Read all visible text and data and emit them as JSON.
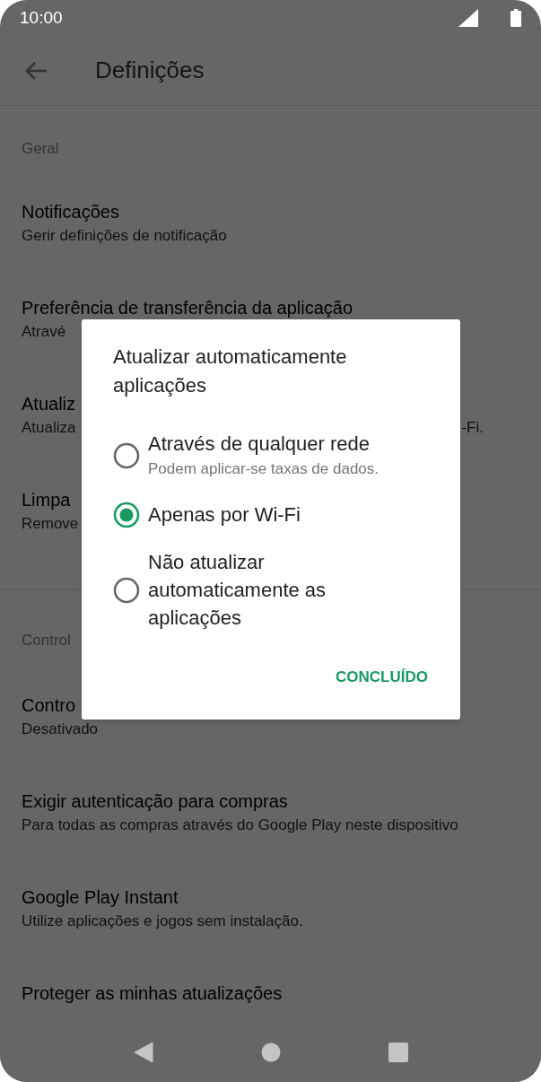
{
  "status_bar": {
    "time": "10:00"
  },
  "toolbar": {
    "title": "Definições"
  },
  "sections": [
    {
      "header": "Geral",
      "items": [
        {
          "title": "Notificações",
          "subtitle": "Gerir definições de notificação"
        },
        {
          "title": "Preferência de transferência da aplicação",
          "subtitle": "Atravé"
        },
        {
          "title": "Atualiz",
          "subtitle": "Atualiza",
          "subtitle_end": "-Fi."
        },
        {
          "title": "Limpa",
          "subtitle": "Remove"
        }
      ]
    },
    {
      "header": "Control",
      "items": [
        {
          "title": "Contro",
          "subtitle": "Desativado"
        },
        {
          "title": "Exigir autenticação para compras",
          "subtitle": "Para todas as compras através do Google Play neste dispositivo"
        },
        {
          "title": "Google Play Instant",
          "subtitle": "Utilize aplicações e jogos sem instalação."
        },
        {
          "title": "Proteger as minhas atualizações"
        }
      ]
    }
  ],
  "dialog": {
    "title": "Atualizar automaticamente aplicações",
    "options": [
      {
        "label": "Através de qualquer rede",
        "subtitle": "Podem aplicar-se taxas de dados.",
        "selected": false
      },
      {
        "label": "Apenas por Wi-Fi",
        "selected": true
      },
      {
        "label": "Não atualizar automaticamente as aplicações",
        "selected": false
      }
    ],
    "button": "CONCLUÍDO"
  }
}
